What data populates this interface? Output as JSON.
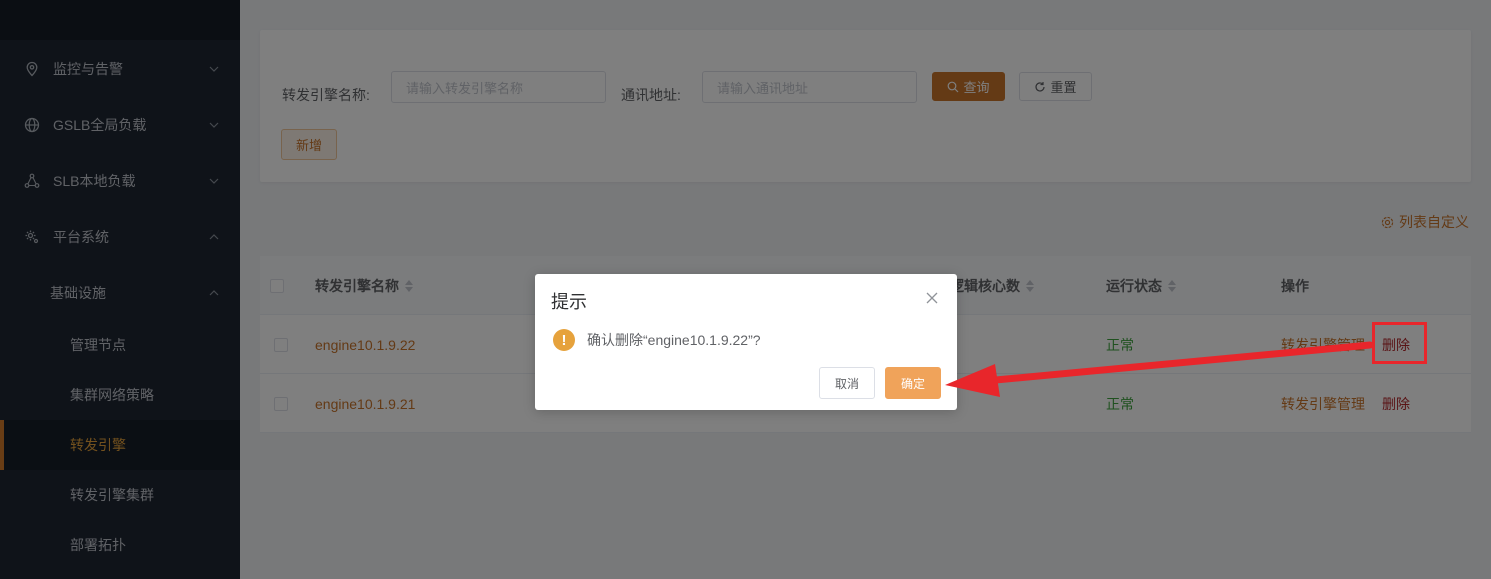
{
  "sidebar": {
    "items": [
      {
        "label": "监控与告警",
        "icon": "location-pin-icon",
        "expanded": false
      },
      {
        "label": "GSLB全局负载",
        "icon": "globe-icon",
        "expanded": false
      },
      {
        "label": "SLB本地负载",
        "icon": "network-nodes-icon",
        "expanded": false
      },
      {
        "label": "平台系统",
        "icon": "gear-icon",
        "expanded": true
      }
    ],
    "group": {
      "label": "基础设施",
      "expanded": true
    },
    "sub_items": [
      {
        "label": "管理节点",
        "active": false
      },
      {
        "label": "集群网络策略",
        "active": false
      },
      {
        "label": "转发引擎",
        "active": true
      },
      {
        "label": "转发引擎集群",
        "active": false
      },
      {
        "label": "部署拓扑",
        "active": false
      }
    ]
  },
  "search": {
    "name_label": "转发引擎名称:",
    "name_placeholder": "请输入转发引擎名称",
    "address_label": "通讯地址:",
    "address_placeholder": "请输入通讯地址",
    "query_button": "查询",
    "reset_button": "重置",
    "add_button": "新增"
  },
  "column_customize": "列表自定义",
  "table": {
    "headers": {
      "name": "转发引擎名称",
      "cores": "逻辑核心数",
      "status": "运行状态",
      "actions": "操作"
    },
    "rows": [
      {
        "name": "engine10.1.9.22",
        "status": "正常",
        "manage": "转发引擎管理",
        "delete": "删除"
      },
      {
        "name": "engine10.1.9.21",
        "status": "正常",
        "manage": "转发引擎管理",
        "delete": "删除"
      }
    ]
  },
  "dialog": {
    "title": "提示",
    "message": "确认删除“engine10.1.9.22”?",
    "cancel": "取消",
    "confirm": "确定"
  },
  "colors": {
    "accent": "#c8742b",
    "sidebar_bg": "#1f2733",
    "status_ok": "#3fa33f",
    "danger": "#b3272b",
    "annotation": "#e8262b"
  }
}
